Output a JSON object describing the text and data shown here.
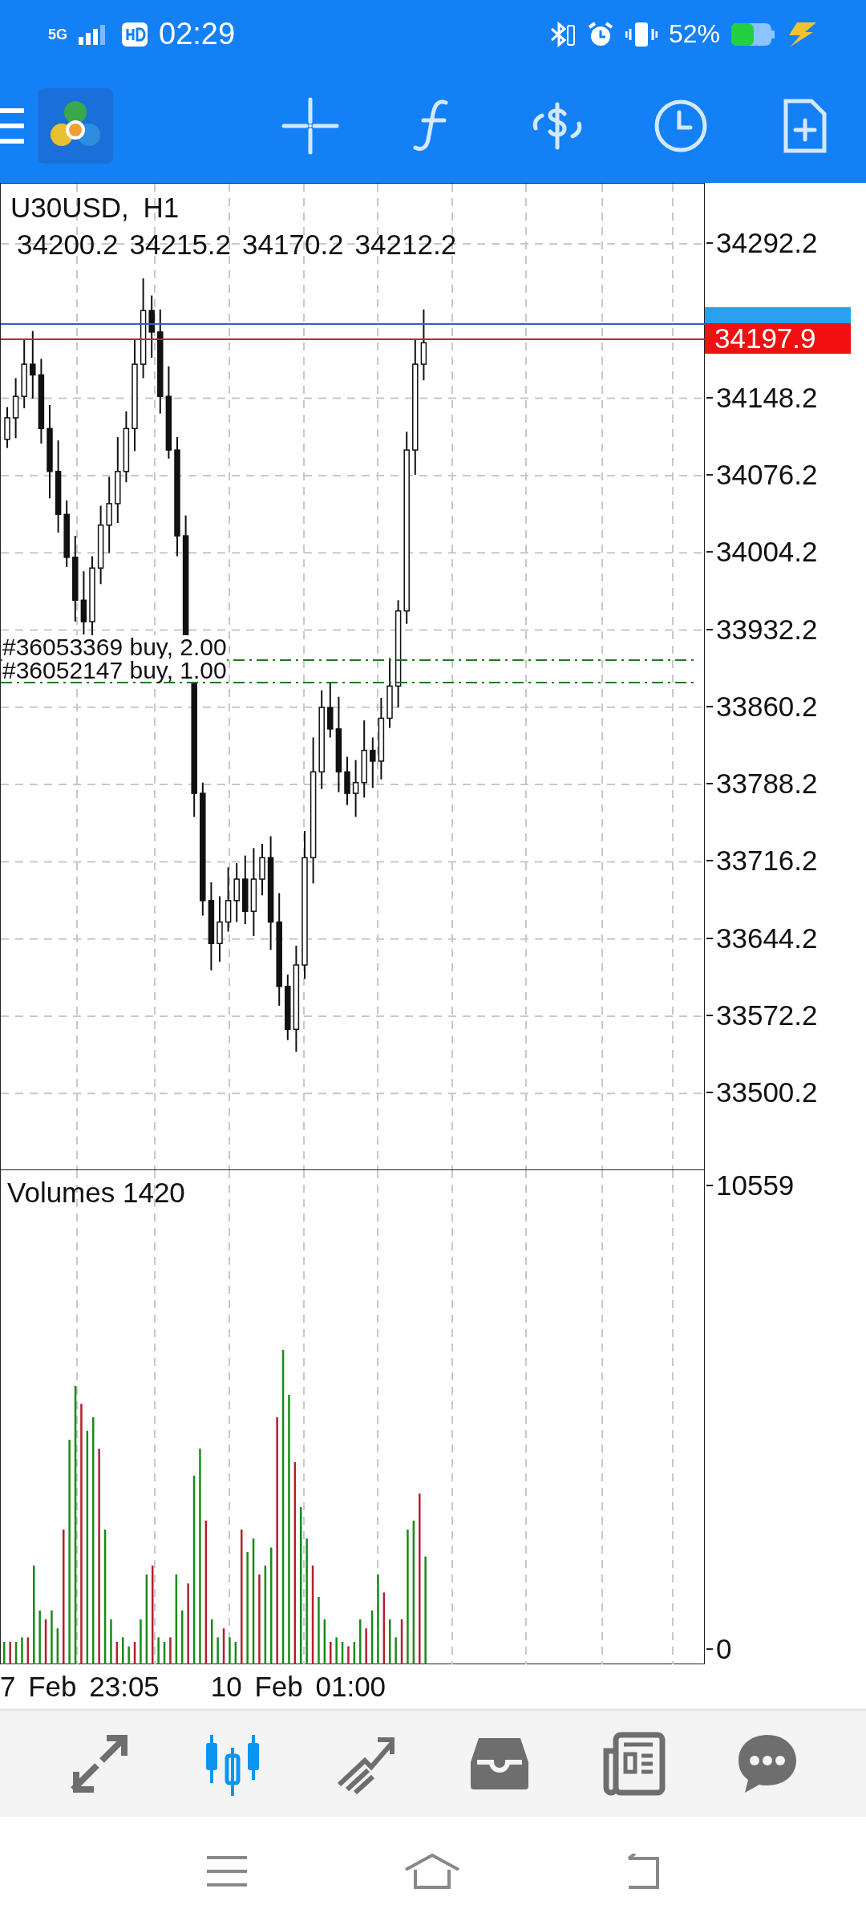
{
  "status_bar": {
    "network": "5G",
    "time": "02:29",
    "battery": "52%"
  },
  "chart": {
    "symbol": "U30USD, H1",
    "ohlc": [
      "34200.2",
      "34215.2",
      "34170.2",
      "34212.2"
    ],
    "price_axis": [
      "34292.2",
      "34148.2",
      "34076.2",
      "34004.2",
      "33932.2",
      "33860.2",
      "33788.2",
      "33716.2",
      "33644.2",
      "33572.2",
      "33500.2"
    ],
    "current_price": "34197.9",
    "orders": [
      "#36053369 buy, 2.00",
      "#36052147 buy, 1.00"
    ]
  },
  "volumes": {
    "label": "Volumes 1420",
    "axis_max": "10559",
    "axis_min": "0"
  },
  "time_axis": [
    "7 Feb 23:05",
    "10 Feb 01:00"
  ],
  "bottom_nav": [
    {
      "kind": "quotes",
      "selected": false
    },
    {
      "kind": "chart",
      "selected": true
    },
    {
      "kind": "trade",
      "selected": false
    },
    {
      "kind": "history",
      "selected": false
    },
    {
      "kind": "news",
      "selected": false
    },
    {
      "kind": "messages",
      "selected": false
    }
  ]
}
